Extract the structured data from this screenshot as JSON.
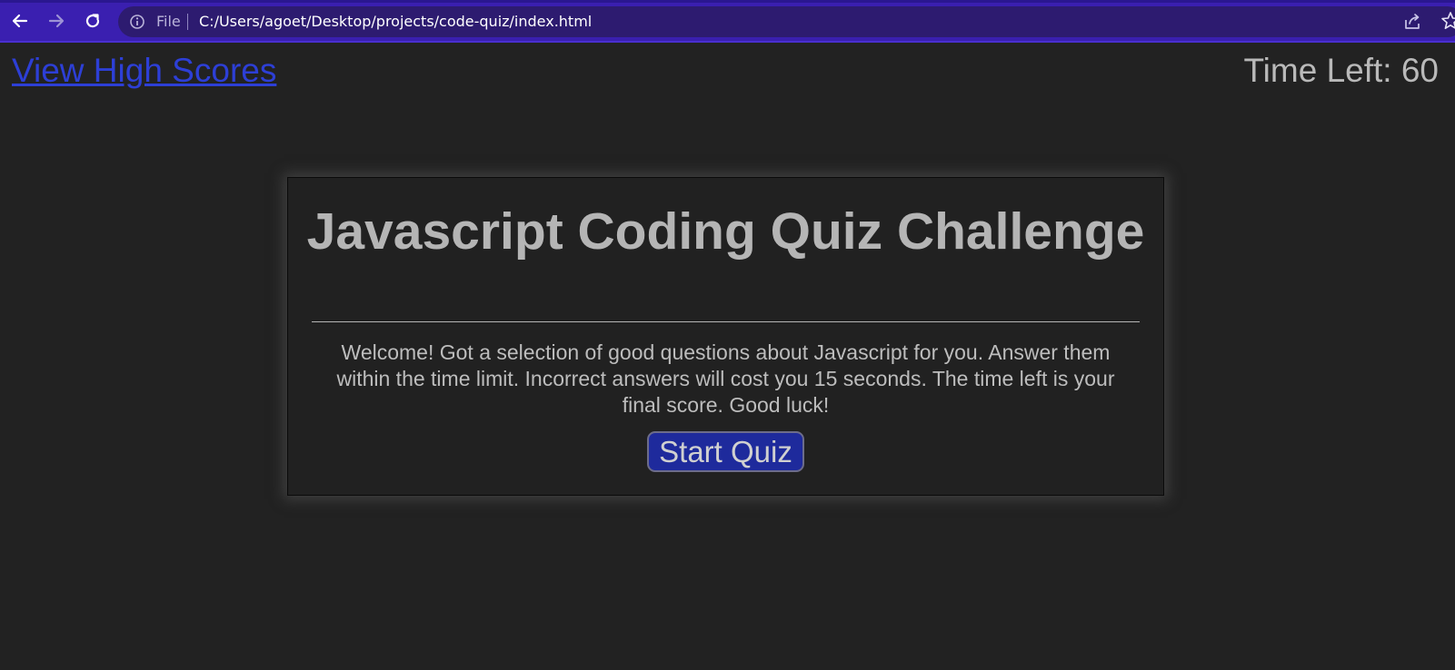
{
  "browser": {
    "file_label": "File",
    "url": "C:/Users/agoet/Desktop/projects/code-quiz/index.html",
    "chrome_color": "#3a1fb0",
    "omnibox_color": "#2d1b70",
    "icons": [
      "back-arrow-icon",
      "forward-arrow-icon",
      "reload-icon",
      "info-icon",
      "share-icon",
      "star-icon"
    ]
  },
  "header": {
    "high_scores_link": "View High Scores",
    "timer_label": "Time Left:",
    "timer_value": "60"
  },
  "quiz": {
    "title": "Javascript Coding Quiz Challenge",
    "intro": "Welcome! Got a selection of good questions about Javascript for you. Answer them within the time limit. Incorrect answers will cost you 15 seconds. The time left is your final score. Good luck!",
    "start_button": "Start Quiz"
  },
  "colors": {
    "page_background": "#222222",
    "link": "#2d3fd6",
    "text": "#b9b9b9",
    "button": "#1e2a9c"
  }
}
